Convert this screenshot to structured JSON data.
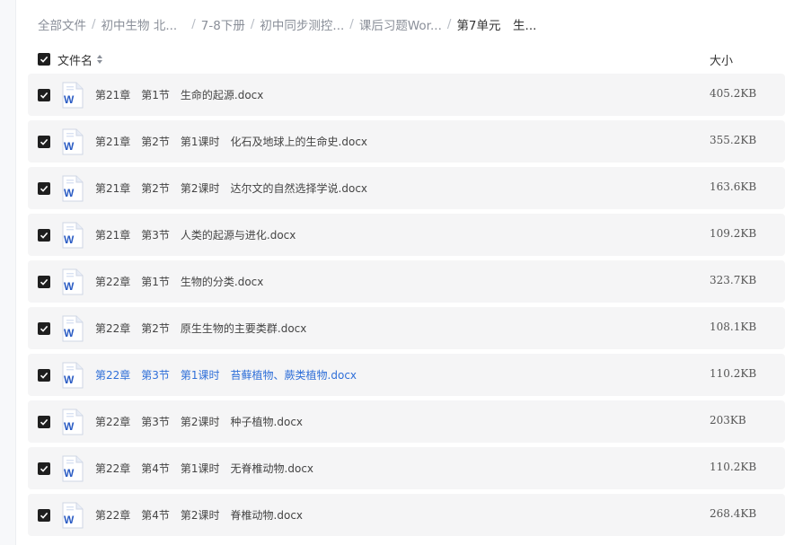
{
  "breadcrumb": [
    {
      "label": "全部文件",
      "current": false
    },
    {
      "label": "初中生物 北...",
      "current": false
    },
    {
      "label": "7-8下册",
      "current": false
    },
    {
      "label": "初中同步测控...",
      "current": false
    },
    {
      "label": "课后习题Wor...",
      "current": false
    },
    {
      "label": "第7单元　生...",
      "current": true
    }
  ],
  "header": {
    "name_label": "文件名",
    "size_label": "大小",
    "sort_icon": "sort-icon"
  },
  "colors": {
    "link": "#2f6fd8",
    "row_bg": "#f5f5f6",
    "word_blue": "#2b5cc4"
  },
  "files": [
    {
      "name": "第21章　第1节　生命的起源.docx",
      "size": "405.2KB",
      "checked": true,
      "link": false,
      "icon": "word-doc-icon"
    },
    {
      "name": "第21章　第2节　第1课时　化石及地球上的生命史.docx",
      "size": "355.2KB",
      "checked": true,
      "link": false,
      "icon": "word-doc-icon"
    },
    {
      "name": "第21章　第2节　第2课时　达尔文的自然选择学说.docx",
      "size": "163.6KB",
      "checked": true,
      "link": false,
      "icon": "word-doc-icon"
    },
    {
      "name": "第21章　第3节　人类的起源与进化.docx",
      "size": "109.2KB",
      "checked": true,
      "link": false,
      "icon": "word-doc-icon"
    },
    {
      "name": "第22章　第1节　生物的分类.docx",
      "size": "323.7KB",
      "checked": true,
      "link": false,
      "icon": "word-doc-icon"
    },
    {
      "name": "第22章　第2节　原生生物的主要类群.docx",
      "size": "108.1KB",
      "checked": true,
      "link": false,
      "icon": "word-doc-icon"
    },
    {
      "name": "第22章　第3节　第1课时　苔藓植物、蕨类植物.docx",
      "size": "110.2KB",
      "checked": true,
      "link": true,
      "icon": "word-doc-icon"
    },
    {
      "name": "第22章　第3节　第2课时　种子植物.docx",
      "size": "203KB",
      "checked": true,
      "link": false,
      "icon": "word-doc-icon"
    },
    {
      "name": "第22章　第4节　第1课时　无脊椎动物.docx",
      "size": "110.2KB",
      "checked": true,
      "link": false,
      "icon": "word-doc-icon"
    },
    {
      "name": "第22章　第4节　第2课时　脊椎动物.docx",
      "size": "268.4KB",
      "checked": true,
      "link": false,
      "icon": "word-doc-icon"
    }
  ]
}
